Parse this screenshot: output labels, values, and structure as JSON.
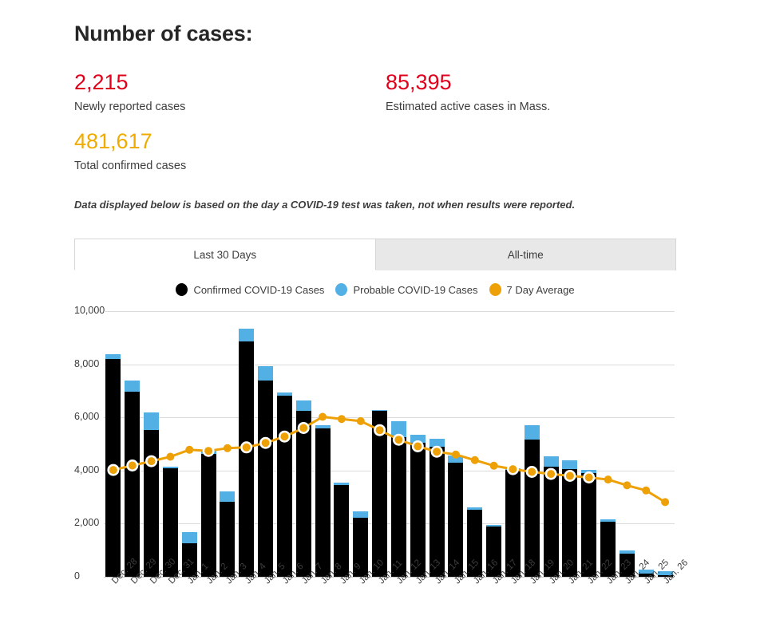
{
  "header": {
    "title": "Number of cases:",
    "stats": [
      {
        "id": "newly-reported",
        "value": "2,215",
        "label": "Newly reported cases",
        "color": "#e0001b"
      },
      {
        "id": "active-cases",
        "value": "85,395",
        "label": "Estimated active cases in Mass.",
        "color": "#e0001b"
      },
      {
        "id": "total-confirmed",
        "value": "481,617",
        "label": "Total confirmed cases",
        "color": "#f0ab00"
      }
    ],
    "note": "Data displayed below is based on the day a COVID-19 test was taken, not when results were reported."
  },
  "tabs": [
    {
      "label": "Last 30 Days",
      "active": true
    },
    {
      "label": "All-time",
      "active": false
    }
  ],
  "legend": [
    {
      "label": "Confirmed COVID-19 Cases",
      "color": "#000000"
    },
    {
      "label": "Probable COVID-19 Cases",
      "color": "#52b0e5"
    },
    {
      "label": "7 Day Average",
      "color": "#eda106"
    }
  ],
  "chart_data": {
    "type": "bar",
    "title": "",
    "xlabel": "",
    "ylabel": "",
    "ylim": [
      0,
      10000
    ],
    "yticks": [
      "0",
      "2,000",
      "4,000",
      "6,000",
      "8,000",
      "10,000"
    ],
    "ytick_values": [
      0,
      2000,
      4000,
      6000,
      8000,
      10000
    ],
    "grid": true,
    "stacked": true,
    "legend_position": "top-center",
    "categories": [
      "Dec. 28",
      "Dec. 29",
      "Dec. 30",
      "Dec. 31",
      "Jan. 1",
      "Jan. 2",
      "Jan. 3",
      "Jan. 4",
      "Jan. 5",
      "Jan. 6",
      "Jan. 7",
      "Jan. 8",
      "Jan. 9",
      "Jan. 10",
      "Jan. 11",
      "Jan. 12",
      "Jan. 13",
      "Jan. 14",
      "Jan. 15",
      "Jan. 16",
      "Jan. 17",
      "Jan. 18",
      "Jan. 19",
      "Jan. 20",
      "Jan. 21",
      "Jan. 22",
      "Jan. 23",
      "Jan. 24",
      "Jan. 25",
      "Jan. 26"
    ],
    "series": [
      {
        "name": "Confirmed COVID-19 Cases",
        "color": "#000000",
        "values": [
          8200,
          6980,
          5540,
          4080,
          1270,
          4620,
          2830,
          8850,
          7400,
          6820,
          6250,
          5600,
          3450,
          2230,
          6250,
          5270,
          5060,
          4900,
          4300,
          2530,
          1900,
          4010,
          5180,
          4130,
          4040,
          3900,
          2080,
          880,
          130,
          60
        ]
      },
      {
        "name": "Probable COVID-19 Cases",
        "color": "#52b0e5",
        "values": [
          180,
          420,
          650,
          60,
          400,
          170,
          380,
          480,
          530,
          130,
          380,
          110,
          100,
          230,
          40,
          600,
          280,
          310,
          280,
          80,
          60,
          80,
          520,
          400,
          350,
          110,
          80,
          100,
          150,
          160
        ]
      }
    ],
    "average_line": {
      "name": "7 Day Average",
      "color": "#eda106",
      "values": [
        4020,
        4190,
        4350,
        4520,
        4780,
        4740,
        4840,
        4870,
        5040,
        5280,
        5600,
        6020,
        5940,
        5860,
        5520,
        5160,
        4910,
        4710,
        4600,
        4390,
        4180,
        4050,
        3950,
        3870,
        3800,
        3740,
        3660,
        3440,
        3250,
        2810
      ]
    }
  }
}
